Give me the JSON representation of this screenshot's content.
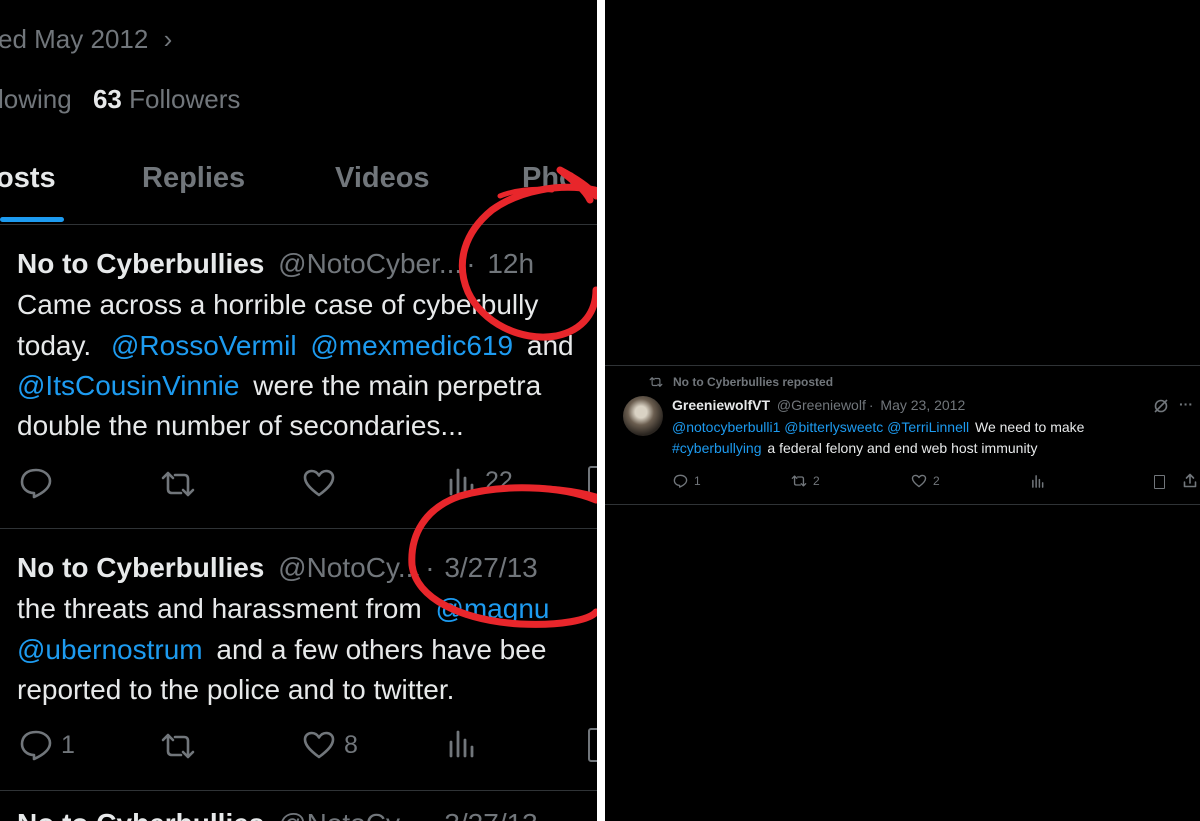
{
  "profile": {
    "joined": "ed May 2012",
    "following_label": "lowing",
    "followers_count": "63",
    "followers_label": "Followers"
  },
  "tabs": [
    "osts",
    "Replies",
    "Videos",
    "Pho"
  ],
  "tweets": [
    {
      "name": "No to Cyberbullies",
      "handle": "@NotoCyber...",
      "time": "12h",
      "lines": {
        "l1": "Came across a horrible case of cyberbully",
        "l2_text": "today.",
        "l2_m1": "@RossoVermil",
        "l2_m2": "@mexmedic619",
        "l2_tail": "and",
        "l3_m": "@ItsCousinVinnie",
        "l3_tail": "were the main perpetra",
        "l4": "double the number of secondaries..."
      },
      "views": "22"
    },
    {
      "name": "No to Cyberbullies",
      "handle": "@NotoCy...",
      "time": "3/27/13",
      "lines": {
        "l1_text": "the threats and harassment from",
        "l1_m": "@magnu",
        "l2_m": "@ubernostrum",
        "l2_tail": "and a few others have bee",
        "l3": "reported to the police and to twitter."
      },
      "replies": "1",
      "likes": "8"
    },
    {
      "name": "No to Cyberbullies",
      "handle": "@NotoCy...",
      "time": "3/27/13"
    }
  ],
  "repost": {
    "label": "No to Cyberbullies reposted",
    "name": "GreeniewolfVT",
    "handle": "@Greeniewolf",
    "date": "May 23, 2012",
    "mentions": "@notocyberbulli1 @bitterlysweetc @TerriLinnell",
    "text1": "We need to make",
    "hashtag": "#cyberbullying",
    "text2": "a federal felony and end web host immunity",
    "replies": "1",
    "reposts": "2",
    "likes": "2"
  },
  "colors": {
    "accent": "#1d9bf0",
    "annotation": "#e8262b",
    "background": "#000000"
  }
}
